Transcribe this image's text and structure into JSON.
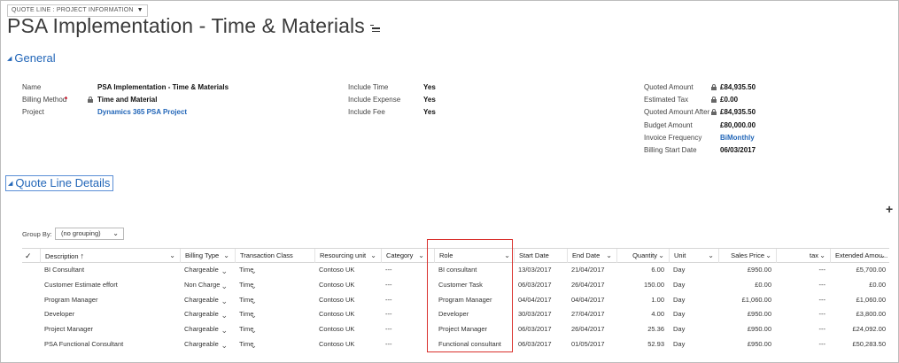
{
  "form_selector": {
    "label": "QUOTE LINE : PROJECT INFORMATION"
  },
  "title": "PSA Implementation - Time & Materials",
  "sections": {
    "general": "General",
    "quote_line_details": "Quote Line Details"
  },
  "general": {
    "col1": [
      {
        "label": "Name",
        "value": "PSA Implementation - Time & Materials",
        "required": false,
        "locked": false,
        "link": false
      },
      {
        "label": "Billing Method",
        "value": "Time and Material",
        "required": true,
        "locked": true,
        "link": false
      },
      {
        "label": "Project",
        "value": "Dynamics 365 PSA Project",
        "required": false,
        "locked": false,
        "link": true
      }
    ],
    "col2": [
      {
        "label": "Include Time",
        "value": "Yes"
      },
      {
        "label": "Include Expense",
        "value": "Yes"
      },
      {
        "label": "Include Fee",
        "value": "Yes"
      }
    ],
    "col3": [
      {
        "label": "Quoted Amount",
        "value": "£84,935.50",
        "locked": true,
        "link": false
      },
      {
        "label": "Estimated Tax",
        "value": "£0.00",
        "locked": true,
        "link": false
      },
      {
        "label": "Quoted Amount After",
        "value": "£84,935.50",
        "locked": true,
        "link": false
      },
      {
        "label": "Budget Amount",
        "value": "£80,000.00",
        "locked": false,
        "link": false
      },
      {
        "label": "Invoice Frequency",
        "value": "BiMonthly",
        "locked": false,
        "link": true
      },
      {
        "label": "Billing Start Date",
        "value": "06/03/2017",
        "locked": false,
        "link": false
      }
    ]
  },
  "group_by": {
    "label": "Group By:",
    "value": "(no grouping)"
  },
  "grid": {
    "headers": {
      "check": "✓",
      "description": "Description",
      "billing_type": "Billing Type",
      "transaction_class": "Transaction Class",
      "resourcing_unit": "Resourcing unit",
      "category": "Category",
      "role": "Role",
      "start_date": "Start Date",
      "end_date": "End Date",
      "quantity": "Quantity",
      "unit": "Unit",
      "sales_price": "Sales Price",
      "tax": "tax",
      "extended_amount": "Extended Amou..."
    },
    "rows": [
      {
        "description": "BI Consultant",
        "billing_type": "Chargeable",
        "transaction_class": "Time",
        "resourcing_unit": "Contoso UK",
        "category": "---",
        "role": "BI consultant",
        "start_date": "13/03/2017",
        "end_date": "21/04/2017",
        "quantity": "6.00",
        "unit": "Day",
        "sales_price": "£950.00",
        "tax": "---",
        "extended_amount": "£5,700.00"
      },
      {
        "description": "Customer Estimate effort",
        "billing_type": "Non Charge",
        "transaction_class": "Time",
        "resourcing_unit": "Contoso UK",
        "category": "---",
        "role": "Customer Task",
        "start_date": "06/03/2017",
        "end_date": "26/04/2017",
        "quantity": "150.00",
        "unit": "Day",
        "sales_price": "£0.00",
        "tax": "---",
        "extended_amount": "£0.00"
      },
      {
        "description": "Program Manager",
        "billing_type": "Chargeable",
        "transaction_class": "Time",
        "resourcing_unit": "Contoso UK",
        "category": "---",
        "role": "Program Manager",
        "start_date": "04/04/2017",
        "end_date": "04/04/2017",
        "quantity": "1.00",
        "unit": "Day",
        "sales_price": "£1,060.00",
        "tax": "---",
        "extended_amount": "£1,060.00"
      },
      {
        "description": "Developer",
        "billing_type": "Chargeable",
        "transaction_class": "Time",
        "resourcing_unit": "Contoso UK",
        "category": "---",
        "role": "Developer",
        "start_date": "30/03/2017",
        "end_date": "27/04/2017",
        "quantity": "4.00",
        "unit": "Day",
        "sales_price": "£950.00",
        "tax": "---",
        "extended_amount": "£3,800.00"
      },
      {
        "description": "Project Manager",
        "billing_type": "Chargeable",
        "transaction_class": "Time",
        "resourcing_unit": "Contoso UK",
        "category": "---",
        "role": "Project Manager",
        "start_date": "06/03/2017",
        "end_date": "26/04/2017",
        "quantity": "25.36",
        "unit": "Day",
        "sales_price": "£950.00",
        "tax": "---",
        "extended_amount": "£24,092.00"
      },
      {
        "description": "PSA Functional Consultant",
        "billing_type": "Chargeable",
        "transaction_class": "Time",
        "resourcing_unit": "Contoso UK",
        "category": "---",
        "role": "Functional consultant",
        "start_date": "06/03/2017",
        "end_date": "01/05/2017",
        "quantity": "52.93",
        "unit": "Day",
        "sales_price": "£950.00",
        "tax": "---",
        "extended_amount": "£50,283.50"
      }
    ]
  },
  "colors": {
    "link": "#2266b8",
    "highlight": "#d9302c",
    "required": "#d0021b"
  }
}
